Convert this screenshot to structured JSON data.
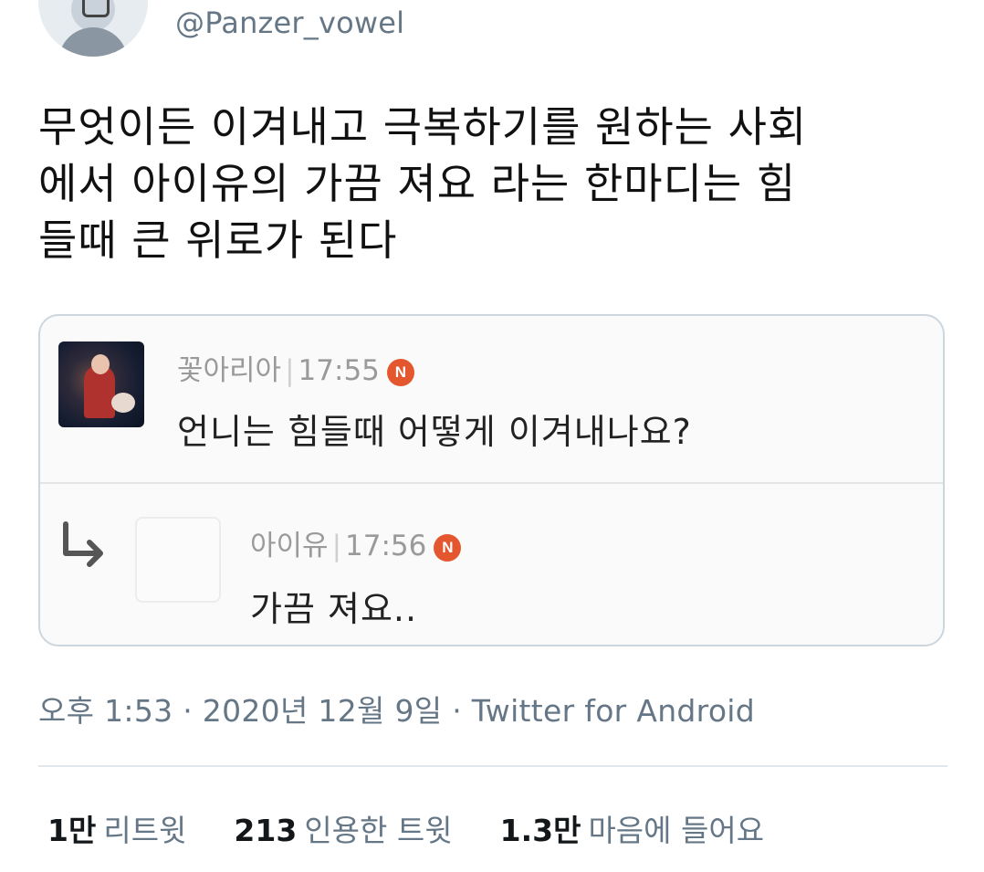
{
  "header": {
    "handle": "@Panzer_vowel"
  },
  "tweet": {
    "text": "무엇이든 이겨내고 극복하기를 원하는 사회\n에서 아이유의 가끔 져요 라는 한마디는 힘\n들때 큰 위로가 된다"
  },
  "embed": {
    "comment": {
      "author": "꽃아리아",
      "time": "17:55",
      "badge": "N",
      "text": "언니는 힘들때 어떻게 이겨내나요?"
    },
    "reply": {
      "author": "아이유",
      "time": "17:56",
      "badge": "N",
      "text": "가끔 져요.."
    },
    "separator": "|"
  },
  "footer": {
    "timestamp": "오후 1:53 · 2020년 12월 9일 · Twitter for Android",
    "stats": [
      {
        "count": "1만",
        "label": "리트윗"
      },
      {
        "count": "213",
        "label": "인용한 트윗"
      },
      {
        "count": "1.3만",
        "label": "마음에 들어요"
      }
    ]
  },
  "colors": {
    "badge": "#e4572e",
    "muted": "#657786",
    "text": "#111111",
    "card_border": "#cdd6dd"
  },
  "icons": {
    "reply_arrow": "reply-arrow-icon",
    "badge": "n-badge-icon"
  }
}
